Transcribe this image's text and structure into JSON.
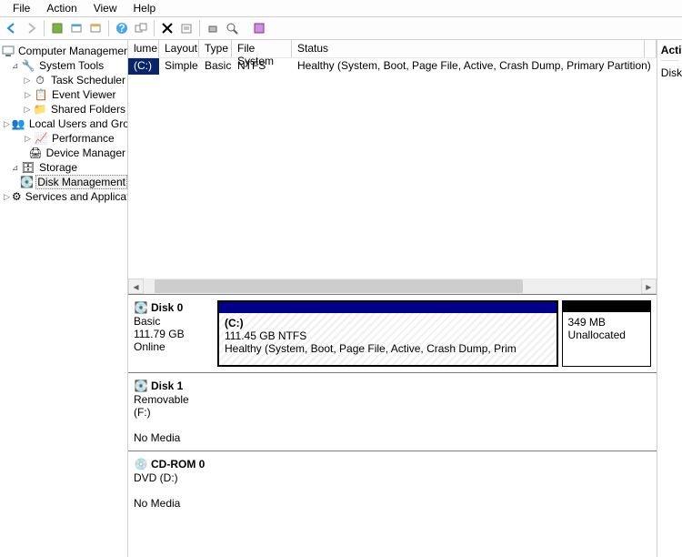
{
  "menu": {
    "file": "File",
    "action": "Action",
    "view": "View",
    "help": "Help"
  },
  "tree": {
    "root": "Computer Management (Local",
    "system_tools": "System Tools",
    "task_scheduler": "Task Scheduler",
    "event_viewer": "Event Viewer",
    "shared_folders": "Shared Folders",
    "local_users": "Local Users and Groups",
    "performance": "Performance",
    "device_manager": "Device Manager",
    "storage": "Storage",
    "disk_management": "Disk Management",
    "services": "Services and Applications"
  },
  "volumes": {
    "headers": {
      "volume": "lume",
      "layout": "Layout",
      "type": "Type",
      "filesystem": "File System",
      "status": "Status"
    },
    "row": {
      "volume": "(C:)",
      "layout": "Simple",
      "type": "Basic",
      "filesystem": "NTFS",
      "status": "Healthy (System, Boot, Page File, Active, Crash Dump, Primary Partition)"
    }
  },
  "disks": {
    "d0": {
      "name": "Disk 0",
      "type": "Basic",
      "size": "111.79 GB",
      "status": "Online",
      "p1": {
        "letter": "(C:)",
        "info": "111.45 GB NTFS",
        "status": "Healthy (System, Boot, Page File, Active, Crash Dump, Prim"
      },
      "p2": {
        "size": "349 MB",
        "status": "Unallocated"
      }
    },
    "d1": {
      "name": "Disk 1",
      "type": "Removable (F:)",
      "media": "No Media"
    },
    "cd": {
      "name": "CD-ROM 0",
      "type": "DVD (D:)",
      "media": "No Media"
    }
  },
  "actions": {
    "title": "Actions",
    "item": "Disk"
  }
}
